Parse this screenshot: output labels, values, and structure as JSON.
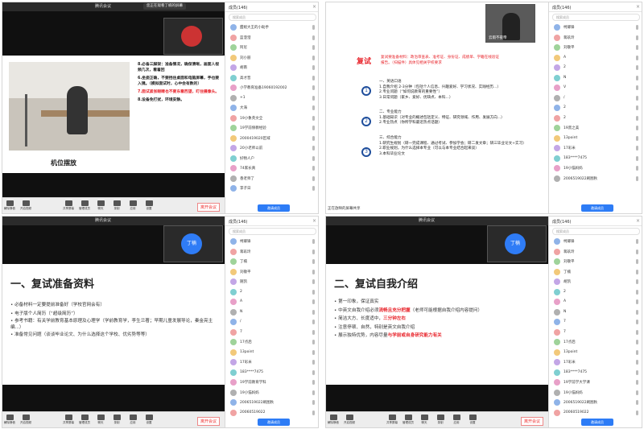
{
  "common": {
    "app_title": "腾讯会议",
    "panel_title": "成员(146)",
    "search_placeholder": "搜索成员",
    "invite_label": "邀请成员",
    "end_label": "离开会议",
    "toolbar": [
      "解除静音",
      "开启视频",
      "共享屏幕",
      "管理成员",
      "聊天",
      "录制",
      "应用",
      "设置"
    ],
    "accent": "#2d7cf6",
    "red": "#e8232a"
  },
  "q1": {
    "share_tip": "您正在观看丁楠的屏幕",
    "caption": "机位摆放",
    "items": [
      "8.必备三脚架：准备情况，确保清晰，画面人视频几次，看着回",
      "6.坐姿正确，不要挡住桌面和电脑屏幕，手也要入镜。（模拟面试时，心中会有数的）",
      "7.面试紧张眼睛也不要东看西望，盯住摄像头。",
      "8.设备免打扰，环境安静。"
    ],
    "participants": [
      "甜妮大王的小助手",
      "蓝澄澄",
      "阿尼",
      "刘小丽",
      "胡南",
      "高才晋",
      "小学教育准备19060192002",
      "+1",
      "大海",
      "19小象英文全",
      "19学前保教经验",
      "2000419020区域",
      "20小老师以前",
      "好物人户",
      "74家长真",
      "香老师了",
      "李子日"
    ]
  },
  "q2": {
    "camera_label": "云雨不夜帝",
    "heading": "复试",
    "intro": "复试要准备材料：政治审查表、准考证、身份证、成绩单、学籍在线验证报告。（扫描件）具体见相关学校要求",
    "s1_title": "一、英语口语",
    "s1_items": [
      "1.自我介绍 2-3分钟（包括个人信息、兴趣爱好、学习状况、实践经历...）",
      "2.专业问题（“如何说教育的重要性”）",
      "3.日常问题（家乡、爱好、优缺点、本科...）"
    ],
    "s2_title": "二、专业能力",
    "s2_items": [
      "1.基础知识（对专业的概述包括定义、特征、研究领域、作用、发展方向...）",
      "2.专业热点（你所学科最近热点话题）"
    ],
    "s3_title": "三、综合能力",
    "s3_items": [
      "1.研究生规划（研一完成课程、通过考试、参加学会；研二发文章；研三毕业论文+实习）",
      "2.职业规划，为什么选择本专业（可以与本专业结合起来谈）",
      "3.本科毕业论文"
    ],
    "bottom_tip": "正在放映的屏幕共享",
    "participants": [
      "柯卿锋",
      "蒋玖玲",
      "刘敬平",
      "A",
      "2",
      "N",
      "V",
      "/",
      "2",
      "2",
      "19黑之美",
      "13point",
      "17彩米",
      "183****7475",
      "19小猫妈妈",
      "2006519022刷图秋"
    ]
  },
  "q3": {
    "presenter": "丁楠",
    "title": "一、复试准备资料",
    "items": [
      "必备材料一定要提前准备好（学校官网会有）",
      "电子版个人简历（“超级简历”）",
      "参考书籍：有关学前教育基本原理及心理学（学前教育学，李生兰著；早期儿童发展导论，秦金亮主编...）",
      "准备常见问题（谈谈毕业论文、为什么选择这个学校、优劣势等等）"
    ],
    "participants": [
      "柯卿锋",
      "蒋玖玲",
      "丁楠",
      "刘敬平",
      "随凯",
      "2",
      "A",
      "N",
      "/",
      "7",
      "17点后",
      "13point",
      "17彩米",
      "183****7475",
      "19学前教育学科",
      "19小猫妈妈",
      "2006519022刷图秋",
      "20060519022"
    ]
  },
  "q4": {
    "presenter": "丁楠",
    "title": "二、复试自我介绍",
    "items": [
      {
        "pre": "第一印象，保证真实",
        "em": "",
        "post": ""
      },
      {
        "pre": "中英文自我介绍必须",
        "em": "流畅且充分把握",
        "post": "（老师可能根据自我介绍内容提问）"
      },
      {
        "pre": "简洁大方、长度适中，",
        "em": "三分钟左右",
        "post": ""
      },
      {
        "pre": "注意停顿、自然，特别是英文自我介绍",
        "em": "",
        "post": ""
      },
      {
        "pre": "展示独特优势，内容尽量",
        "em": "与学前或自身研究能力有关",
        "post": ""
      }
    ],
    "participants": [
      "柯卿锋",
      "蒋玖玲",
      "刘敬平",
      "丁楠",
      "胡凯",
      "2",
      "A",
      "N",
      "7",
      "7",
      "17点后",
      "13point",
      "17彩米",
      "183****7475",
      "19学前学大学课",
      "19小猫妈妈",
      "2006519022刷图秋",
      "20060519022"
    ]
  }
}
